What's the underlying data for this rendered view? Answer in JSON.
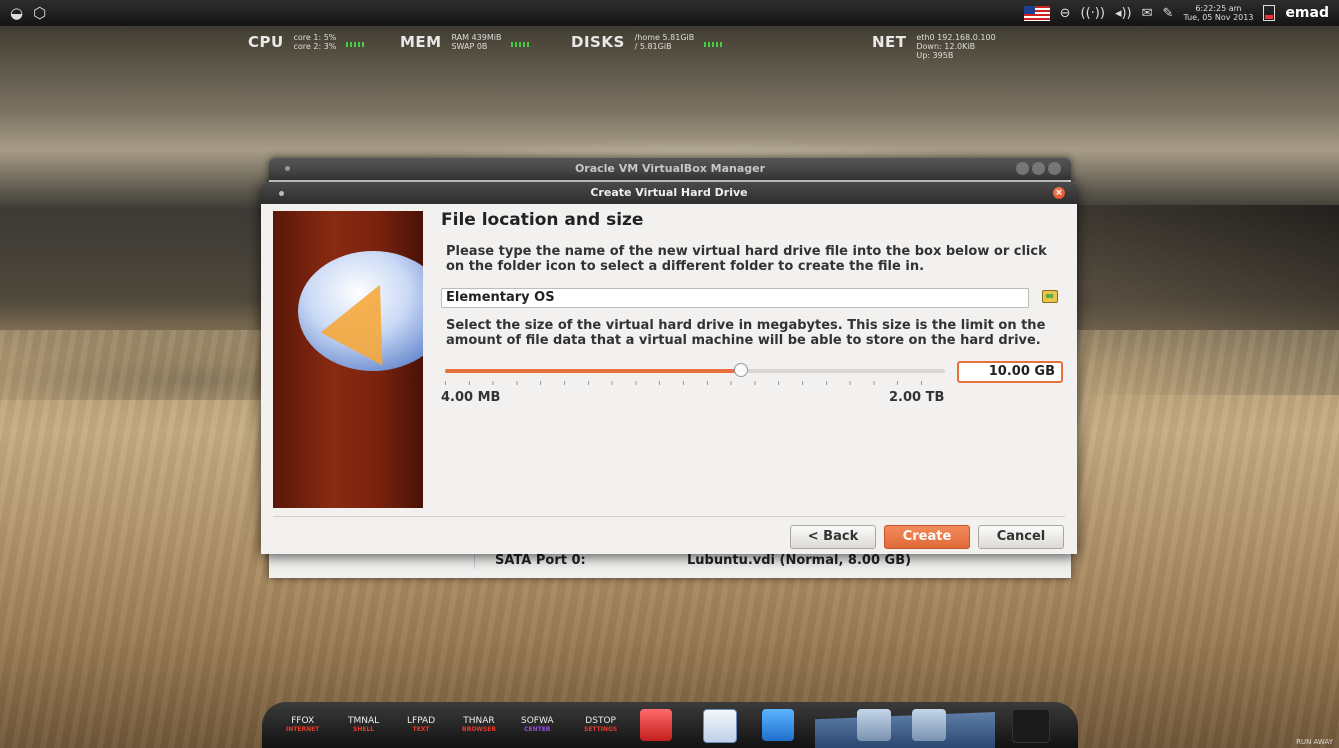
{
  "top_panel": {
    "keyboard_layout_icon": "us-flag-icon",
    "clock_time": "6:22:25 am",
    "clock_date": "Tue, 05 Nov 2013",
    "username": "emad"
  },
  "conky": {
    "cpu_label": "CPU",
    "cpu_core1": "core 1:  5%",
    "cpu_core2": "core 2:  3%",
    "mem_label": "MEM",
    "mem_ram": "RAM    439MiB",
    "mem_swap": "SWAP   0B",
    "disks_label": "DISKS",
    "disk_home": "/home     5.81GiB",
    "disk_root": "/           5.81GiB",
    "net_label": "NET",
    "net_iface": "eth0 192.168.0.100",
    "net_down": "Down: 12.0KiB",
    "net_up": "Up: 395B"
  },
  "manager": {
    "title": "Oracle VM VirtualBox Manager",
    "storage_port": "SATA Port 0:",
    "storage_value": "Lubuntu.vdi (Normal, 8.00 GB)"
  },
  "dialog": {
    "title": "Create Virtual Hard Drive",
    "heading": "File location and size",
    "location_text": "Please type the name of the new virtual hard drive file into the box below or click on the folder icon to select a different folder to create the file in.",
    "file_name": "Elementary OS",
    "size_text": "Select the size of the virtual hard drive in megabytes. This size is the limit on the amount of file data that a virtual machine will be able to store on the hard drive.",
    "size_value": "10.00 GB",
    "slider_position": 0.59,
    "min_label": "4.00 MB",
    "max_label": "2.00 TB",
    "back_label": "< Back",
    "create_label": "Create",
    "cancel_label": "Cancel",
    "accent_color": "#e8703f"
  },
  "dock": {
    "items": [
      {
        "top": "FFOX",
        "bottom": "INTERNET",
        "color": "#e83a2a"
      },
      {
        "top": "TMNAL",
        "bottom": "SHELL",
        "color": "#e83a2a"
      },
      {
        "top": "LFPAD",
        "bottom": "TEXT",
        "color": "#e83a2a"
      },
      {
        "top": "THNAR",
        "bottom": "BROWSER",
        "color": "#e83a2a"
      },
      {
        "top": "SOFWA",
        "bottom": "CENTER",
        "color": "#9a4be0"
      },
      {
        "top": "DSTOP",
        "bottom": "SETTINGS",
        "color": "#e83a2a"
      }
    ],
    "watermark": "RUN AWAY"
  }
}
